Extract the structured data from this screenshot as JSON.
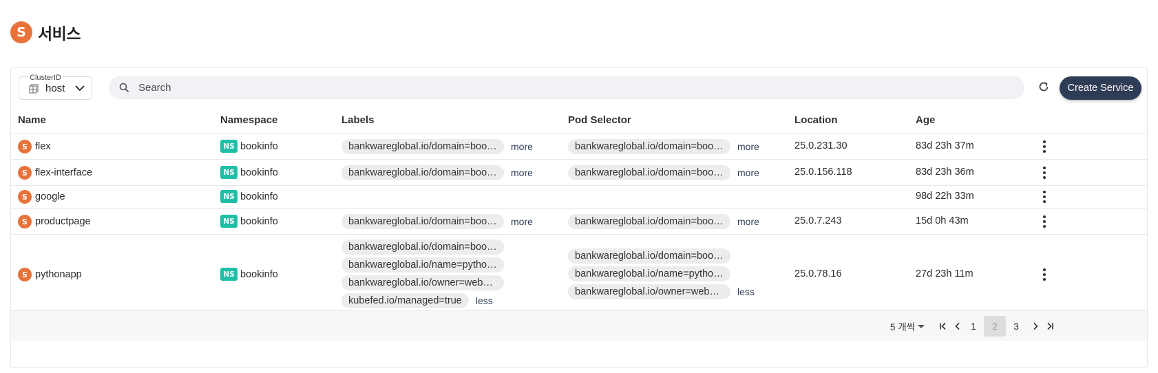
{
  "header": {
    "icon_letter": "S",
    "title": "서비스"
  },
  "toolbar": {
    "cluster_label": "ClusterID",
    "cluster_value": "host",
    "search_placeholder": "Search",
    "create_label": "Create Service"
  },
  "columns": {
    "name": "Name",
    "namespace": "Namespace",
    "labels": "Labels",
    "pod_selector": "Pod Selector",
    "location": "Location",
    "age": "Age"
  },
  "badges": {
    "service": "S",
    "namespace": "NS"
  },
  "rows": [
    {
      "name": "flex",
      "namespace": "bookinfo",
      "labels": [
        "bankwareglobal.io/domain=bookinfo"
      ],
      "labels_link": "more",
      "selector": [
        "bankwareglobal.io/domain=bookinfo"
      ],
      "selector_link": "more",
      "location": "25.0.231.30",
      "age": "83d 23h 37m"
    },
    {
      "name": "flex-interface",
      "namespace": "bookinfo",
      "labels": [
        "bankwareglobal.io/domain=bookinfo"
      ],
      "labels_link": "more",
      "selector": [
        "bankwareglobal.io/domain=bookinfo"
      ],
      "selector_link": "more",
      "location": "25.0.156.118",
      "age": "83d 23h 36m"
    },
    {
      "name": "google",
      "namespace": "bookinfo",
      "labels": [],
      "labels_link": "",
      "selector": [],
      "selector_link": "",
      "location": "",
      "age": "98d 22h 33m"
    },
    {
      "name": "productpage",
      "namespace": "bookinfo",
      "labels": [
        "bankwareglobal.io/domain=bookinfo"
      ],
      "labels_link": "more",
      "selector": [
        "bankwareglobal.io/domain=bookinfo"
      ],
      "selector_link": "more",
      "location": "25.0.7.243",
      "age": "15d 0h 43m"
    },
    {
      "name": "pythonapp",
      "namespace": "bookinfo",
      "labels": [
        "bankwareglobal.io/domain=bookinfo",
        "bankwareglobal.io/name=pythonapp",
        "bankwareglobal.io/owner=webapp",
        "kubefed.io/managed=true"
      ],
      "labels_link": "less",
      "selector": [
        "bankwareglobal.io/domain=bookinfo",
        "bankwareglobal.io/name=pythonapp",
        "bankwareglobal.io/owner=webapp"
      ],
      "selector_link": "less",
      "location": "25.0.78.16",
      "age": "27d 23h 11m"
    }
  ],
  "pagination": {
    "rows_per_page": "5 개씩",
    "pages": [
      "1",
      "2",
      "3"
    ],
    "current_page": "2"
  },
  "icons": {
    "search": "search-icon",
    "refresh": "refresh-icon",
    "cluster": "cluster-icon",
    "dropdown": "chevron-down-icon",
    "row_menu": "more-vert-icon",
    "first": "first-page-icon",
    "prev": "prev-page-icon",
    "next": "next-page-icon",
    "last": "last-page-icon"
  }
}
